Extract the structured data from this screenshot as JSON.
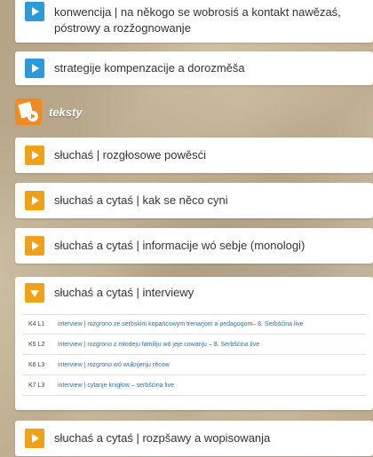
{
  "top_cards": [
    {
      "label_line1": "konwencija | na někogo se wobrosiś a kontakt nawězaś,",
      "label_line2": "póstrowy a rozžognowanje",
      "color": "#2a9bd8"
    },
    {
      "label": "strategije kompenzacije a dorozměša",
      "color": "#2a9bd8"
    }
  ],
  "section": {
    "title": "teksty",
    "icon": "text-audio-icon",
    "color": "#ee8a22"
  },
  "cards": [
    {
      "label": "słuchaś | rozgłosowe powěsći"
    },
    {
      "label": "słuchaś a cytaś | kak se něco cyni"
    },
    {
      "label": "słuchaś a cytaś | informacije wó sebje (monologi)"
    }
  ],
  "expanded": {
    "label": "słuchaś a cytaś | interviewy",
    "items": [
      {
        "code": "K4 L1",
        "text": "interview | rozgrono ze serbskim kopańcowym trenarjom a pedagogom– 8. Serbšćina live"
      },
      {
        "code": "K5 L2",
        "text": "interview | rozgrono z młodeju familiju wó jeje cowanju – 8. Serbšćina live"
      },
      {
        "code": "K6 L3",
        "text": "interview | rozgrono wó wuknjenju rěcow"
      },
      {
        "code": "K7 L3",
        "text": "interview | cytanje knigłow – serbšćina live"
      }
    ]
  },
  "bottom_card": {
    "label": "słuchaś a cytaś | rozpšawy a wopisowanja"
  }
}
